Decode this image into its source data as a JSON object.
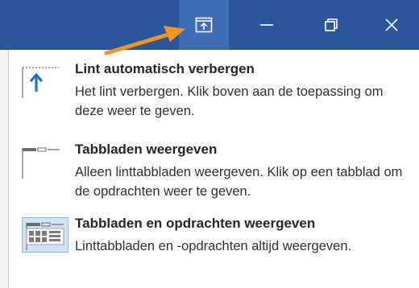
{
  "titlebar": {
    "ribbon_options_icon": "ribbon-display-options-icon",
    "minimize_icon": "minimize-icon",
    "restore_icon": "restore-icon",
    "close_icon": "close-icon",
    "accent_color": "#2b579a"
  },
  "annotation": {
    "arrow_color": "#f39322"
  },
  "menu": {
    "items": [
      {
        "title": "Lint automatisch verbergen",
        "desc": "Het lint verbergen. Klik boven aan de toepassing om deze weer te geven.",
        "icon": "auto-hide-ribbon-icon"
      },
      {
        "title": "Tabbladen weergeven",
        "desc": "Alleen linttabbladen weergeven. Klik op een tabblad om de opdrachten weer te geven.",
        "icon": "show-tabs-icon"
      },
      {
        "title": "Tabbladen en opdrachten weergeven",
        "desc": "Linttabbladen en -opdrachten altijd weergeven.",
        "icon": "show-tabs-and-commands-icon",
        "selected": true
      }
    ]
  }
}
